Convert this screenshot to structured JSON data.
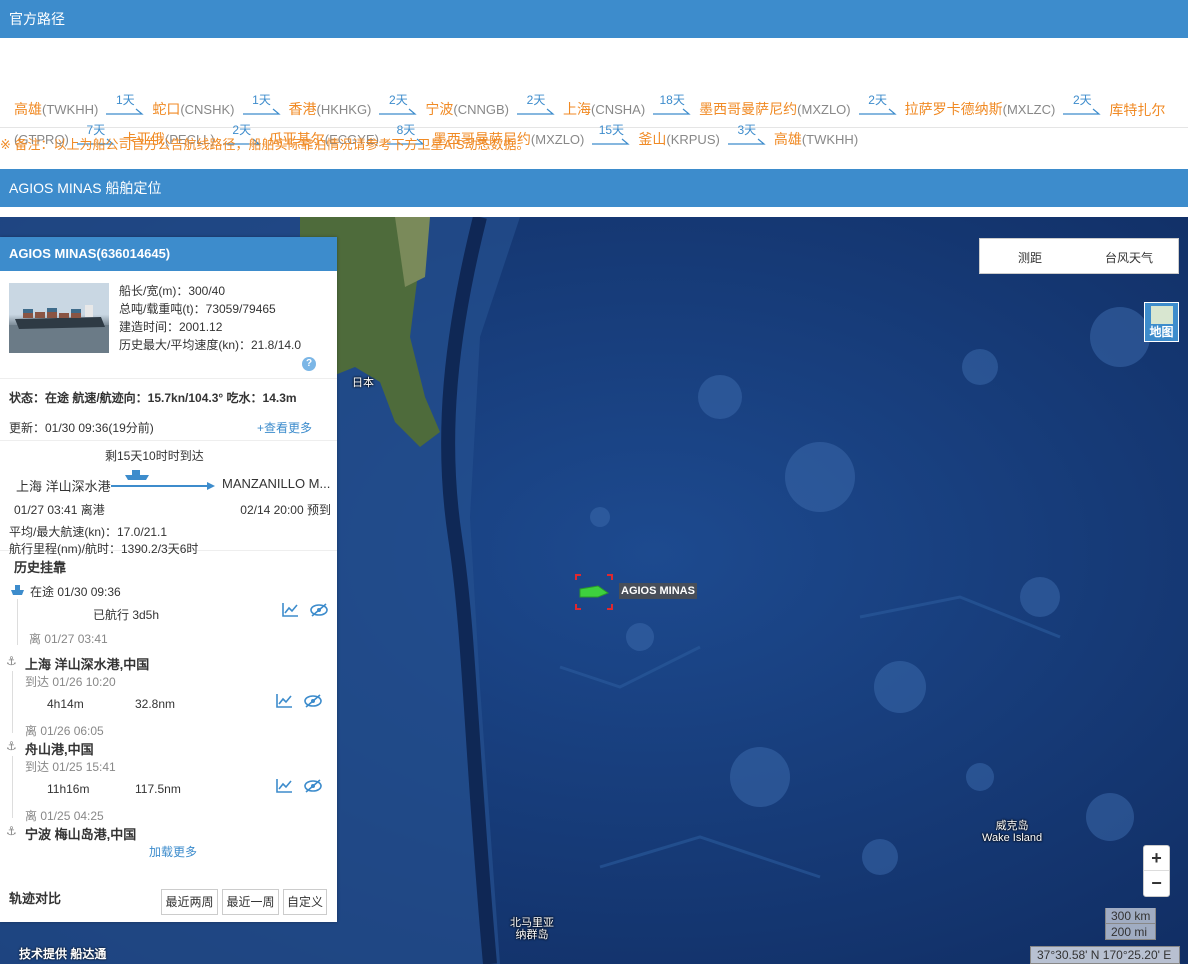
{
  "sections": {
    "route_title": "官方路径",
    "position_title": "AGIOS MINAS 船舶定位"
  },
  "route": {
    "line1": [
      {
        "name": "高雄",
        "code": "(TWKHH)"
      },
      {
        "days": "1天"
      },
      {
        "name": "蛇口",
        "code": "(CNSHK)"
      },
      {
        "days": "1天"
      },
      {
        "name": "香港",
        "code": "(HKHKG)"
      },
      {
        "days": "2天"
      },
      {
        "name": "宁波",
        "code": "(CNNGB)"
      },
      {
        "days": "2天"
      },
      {
        "name": "上海",
        "code": "(CNSHA)"
      },
      {
        "days": "18天"
      },
      {
        "name": "墨西哥曼萨尼约",
        "code": "(MXZLO)"
      },
      {
        "days": "2天"
      },
      {
        "name": "拉萨罗卡德纳斯",
        "code": "(MXLZC)"
      },
      {
        "days": "2天"
      },
      {
        "name": "库特扎尔",
        "code": ""
      }
    ],
    "line2_first_code": "(GTPRQ)",
    "line2": [
      {
        "days": "7天"
      },
      {
        "name": "卡亚俄",
        "code": "(PECLL)"
      },
      {
        "days": "2天"
      },
      {
        "name": "瓜亚基尔",
        "code": "(ECGYE)"
      },
      {
        "days": "8天"
      },
      {
        "name": "墨西哥曼萨尼约",
        "code": "(MXZLO)"
      },
      {
        "days": "15天"
      },
      {
        "name": "釜山",
        "code": "(KRPUS)"
      },
      {
        "days": "3天"
      },
      {
        "name": "高雄",
        "code": "(TWKHH)"
      }
    ],
    "note": "※ 备注：以上为船公司官方公告航线路径，船舶实际靠泊情况请参考下方卫星AIS动态数据。"
  },
  "panel": {
    "header": "AGIOS MINAS(636014645)",
    "specs": {
      "size": "船长/宽(m)：300/40",
      "tonnage": "总吨/载重吨(t)：73059/79465",
      "built": "建造时间：2001.12",
      "speed": "历史最大/平均速度(kn)：21.8/14.0"
    },
    "help": "?",
    "status_line": "状态：在途 航速/航迹向：15.7kn/104.3° 吃水：14.3m",
    "update": "更新：01/30 09:36(19分前)",
    "more_link": "+查看更多",
    "voyage": {
      "remain": "剩15天10时时到达",
      "from": "上海 洋山深水港",
      "to": "MANZANILLO M...",
      "depart_time": "01/27 03:41 离港",
      "eta": "02/14 20:00 预到",
      "avg_speed": "平均/最大航速(kn)：17.0/21.1",
      "distance": "航行里程(nm)/航时：1390.2/3天6时"
    },
    "history": {
      "title": "历史挂靠",
      "current": "在途 01/30 09:36",
      "sailed": "已航行 3d5h",
      "leave1": "离 01/27 03:41",
      "port1": "上海 洋山深水港,中国",
      "arrive1": "到达 01/26 10:20",
      "dur1": "4h14m",
      "nm1": "32.8nm",
      "leave2": "离 01/26 06:05",
      "port2": "舟山港,中国",
      "arrive2": "到达 01/25 15:41",
      "dur2": "11h16m",
      "nm2": "117.5nm",
      "leave3": "离 01/25 04:25",
      "port3": "宁波 梅山岛港,中国",
      "load_more": "加载更多"
    },
    "compare": {
      "label": "轨迹对比",
      "btn_two_weeks": "最近两周",
      "btn_one_week": "最近一周",
      "btn_custom": "自定义"
    }
  },
  "map": {
    "tool_distance": "测距",
    "tool_typhoon": "台风天气",
    "map_type": "地图",
    "label_japan": "日本",
    "label_wake_cn": "威克岛",
    "label_wake_en": "Wake Island",
    "label_nmi_1": "北马里亚",
    "label_nmi_2": "纳群岛",
    "ship_label": "AGIOS MINAS",
    "zoom_in": "+",
    "zoom_out": "−",
    "scale_km": "300 km",
    "scale_mi": "200 mi",
    "coords": "37°30.58' N 170°25.20' E",
    "credit": "技术提供 船达通"
  },
  "colors": {
    "header_blue": "#3d8ccc",
    "port_orange": "#f08a24",
    "ocean": "#163a78",
    "ship_green": "#3ed13e",
    "target_red": "#e0282e"
  }
}
